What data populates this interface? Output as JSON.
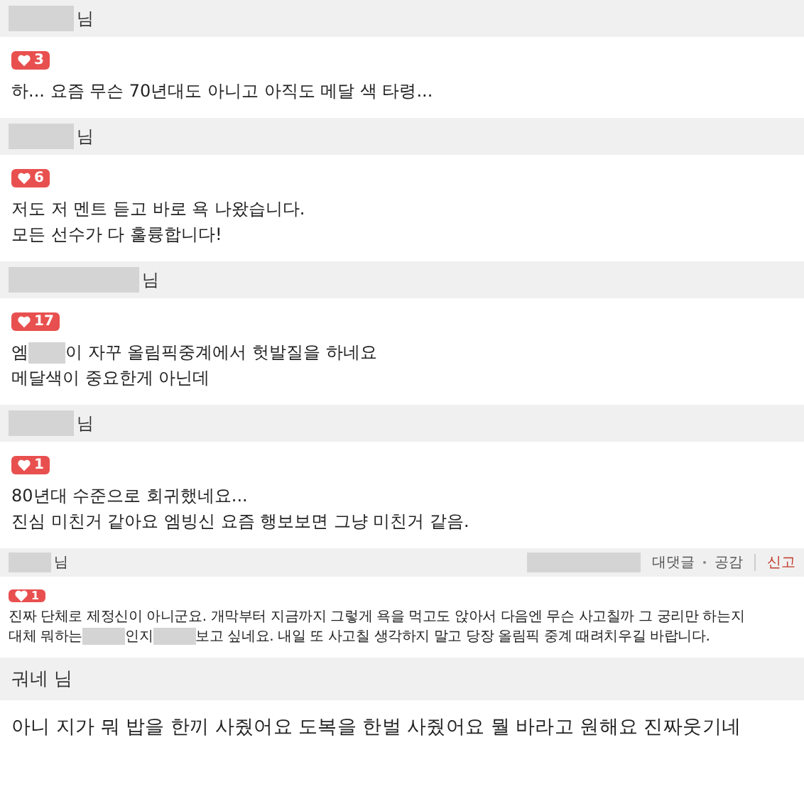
{
  "comments": [
    {
      "kind": "normal",
      "author": [
        {
          "kind": "redacted"
        },
        {
          "kind": "text",
          "text": "님"
        }
      ],
      "likes": "3",
      "lines": [
        [
          {
            "kind": "text",
            "text": "하... 요즘 무슨 70년대도 아니고 아직도 메달 색 타령..."
          }
        ]
      ]
    },
    {
      "kind": "normal",
      "author": [
        {
          "kind": "redacted"
        },
        {
          "kind": "text",
          "text": "님"
        }
      ],
      "likes": "6",
      "lines": [
        [
          {
            "kind": "text",
            "text": "저도 저 멘트 듣고 바로 욕 나왔습니다."
          }
        ],
        [
          {
            "kind": "text",
            "text": "모든 선수가 다 훌륭합니다!"
          }
        ]
      ]
    },
    {
      "kind": "normal",
      "author": [
        {
          "kind": "redacted"
        },
        {
          "kind": "redacted"
        },
        {
          "kind": "text",
          "text": "님"
        }
      ],
      "likes": "17",
      "lines": [
        [
          {
            "kind": "text",
            "text": "엠"
          },
          {
            "kind": "redacted"
          },
          {
            "kind": "text",
            "text": "이 자꾸 올림픽중계에서 헛발질을 하네요"
          }
        ],
        [
          {
            "kind": "text",
            "text": "메달색이 중요한게 아닌데"
          }
        ]
      ]
    },
    {
      "kind": "normal",
      "author": [
        {
          "kind": "redacted"
        },
        {
          "kind": "text",
          "text": "님"
        }
      ],
      "likes": "1",
      "lines": [
        [
          {
            "kind": "text",
            "text": "80년대 수준으로 회귀했네요..."
          }
        ],
        [
          {
            "kind": "text",
            "text": "진심 미친거 같아요 엠빙신 요즘 행보보면 그냥 미친거 같음."
          }
        ]
      ]
    },
    {
      "kind": "small",
      "author": [
        {
          "kind": "redacted"
        },
        {
          "kind": "text",
          "text": "님"
        }
      ],
      "actions": [
        {
          "label": "대댓글",
          "kind": "plain"
        },
        {
          "label": "공감",
          "kind": "plain"
        },
        {
          "label": "신고",
          "kind": "alert"
        }
      ],
      "likes": "1",
      "lines": [
        [
          {
            "kind": "text",
            "text": "진짜 단체로 제정신이 아니군요. 개막부터 지금까지 그렇게 욕을 먹고도 앉아서 다음엔 무슨 사고칠까 그 궁리만 하는지"
          }
        ],
        [
          {
            "kind": "text",
            "text": "대체 뭐하는"
          },
          {
            "kind": "redacted"
          },
          {
            "kind": "text",
            "text": "인지"
          },
          {
            "kind": "redacted"
          },
          {
            "kind": "text",
            "text": "보고 싶네요. 내일 또 사고칠 생각하지 말고 당장 올림픽 중계 때려치우길 바랍니다."
          }
        ]
      ]
    },
    {
      "kind": "plain",
      "author": [
        {
          "kind": "text",
          "text": "궈네 님"
        }
      ],
      "lines": [
        [
          {
            "kind": "text",
            "text": "아니 지가 뭐 밥을 한끼 사줬어요 도복을 한벌 사줬어요 뭘 바라고 원해요 진짜웃기네"
          }
        ]
      ]
    }
  ]
}
